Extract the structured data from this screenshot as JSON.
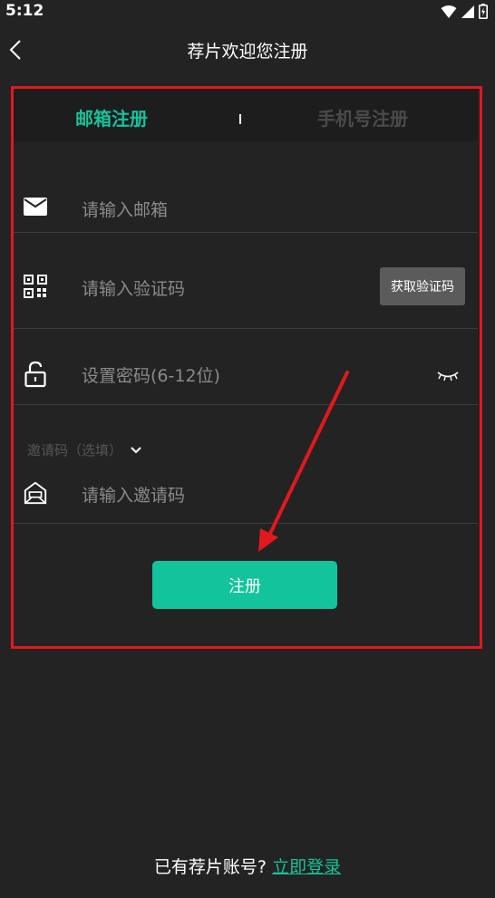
{
  "status_bar": {
    "time": "5:12",
    "icons": [
      "wifi-icon",
      "cell-signal-icon",
      "battery-icon"
    ]
  },
  "nav": {
    "title": "荐片欢迎您注册",
    "back_icon": "chevron-left-icon"
  },
  "tabs": [
    {
      "label": "邮箱注册",
      "active": true
    },
    {
      "label": "手机号注册",
      "active": false
    }
  ],
  "form": {
    "email": {
      "icon": "mail-icon",
      "placeholder": "请输入邮箱",
      "value": ""
    },
    "code": {
      "icon": "qr-code-icon",
      "placeholder": "请输入验证码",
      "value": "",
      "button_label": "获取验证码"
    },
    "password": {
      "icon": "unlock-icon",
      "placeholder": "设置密码(6-12位)",
      "value": "",
      "toggle_icon": "eye-closed-icon"
    },
    "invite": {
      "toggle_label": "邀请码（选填）",
      "toggle_icon": "chevron-down-icon",
      "icon": "invite-envelope-icon",
      "placeholder": "请输入邀请码",
      "value": ""
    },
    "submit_label": "注册"
  },
  "footer": {
    "text": "已有荐片账号?",
    "link_label": "立即登录"
  },
  "colors": {
    "background": "#232323",
    "accent": "#12c39b",
    "highlight": "#e0191f",
    "placeholder": "#8a8a8a"
  }
}
